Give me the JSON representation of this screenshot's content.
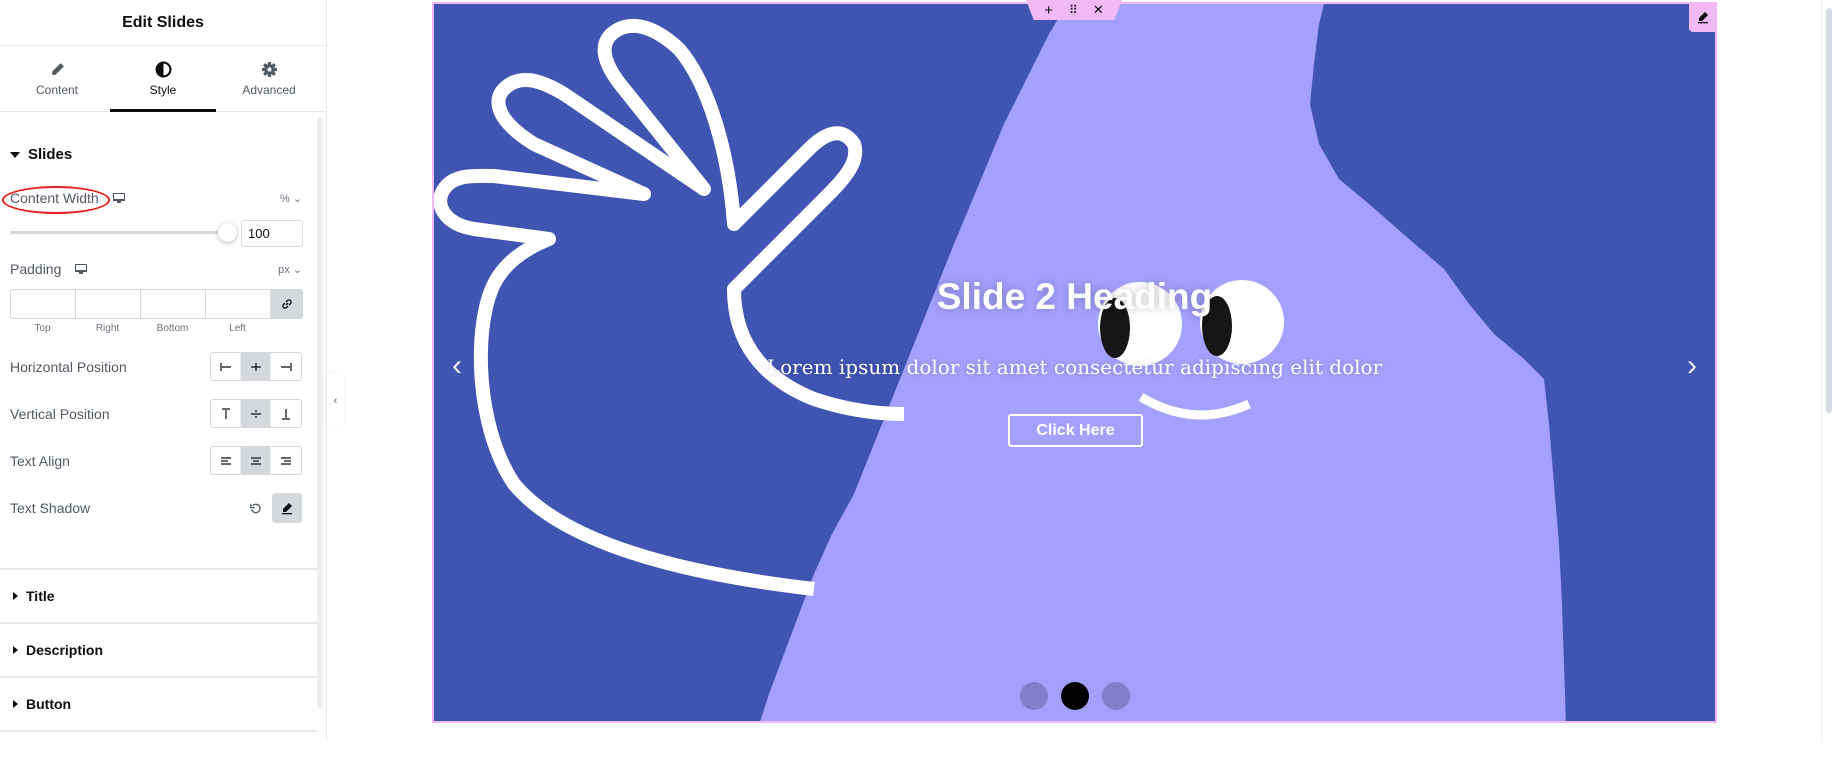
{
  "panel": {
    "title": "Edit Slides",
    "tabs": [
      {
        "label": "Content",
        "icon": "pencil-icon",
        "active": false
      },
      {
        "label": "Style",
        "icon": "half-circle-icon",
        "active": true
      },
      {
        "label": "Advanced",
        "icon": "gear-icon",
        "active": false
      }
    ],
    "section": {
      "title": "Slides",
      "content_width": {
        "label": "Content Width",
        "unit": "%",
        "value": "100",
        "slider_percent": 100
      },
      "padding": {
        "label": "Padding",
        "unit": "px",
        "fields": [
          "Top",
          "Right",
          "Bottom",
          "Left"
        ],
        "values": [
          "",
          "",
          "",
          ""
        ]
      },
      "horizontal_position": {
        "label": "Horizontal Position",
        "options": [
          "left",
          "center",
          "right"
        ],
        "selected": "center"
      },
      "vertical_position": {
        "label": "Vertical Position",
        "options": [
          "top",
          "middle",
          "bottom"
        ],
        "selected": "middle"
      },
      "text_align": {
        "label": "Text Align",
        "options": [
          "left",
          "center",
          "right"
        ],
        "selected": "center"
      },
      "text_shadow": {
        "label": "Text Shadow"
      }
    },
    "collapsed_sections": [
      "Title",
      "Description",
      "Button"
    ]
  },
  "canvas": {
    "handle_icons": [
      "plus-icon",
      "drag-icon",
      "close-icon"
    ],
    "slide": {
      "heading": "Slide 2 Heading",
      "description": "Lorem ipsum dolor sit amet consectetur adipiscing elit dolor",
      "button_label": "Click Here",
      "prev_arrow": "‹",
      "next_arrow": "›",
      "dots": 3,
      "active_dot": 2,
      "colors": {
        "dark": "#4054b2",
        "light": "#a4a0fd",
        "accent": "#f1b9f5"
      }
    }
  }
}
